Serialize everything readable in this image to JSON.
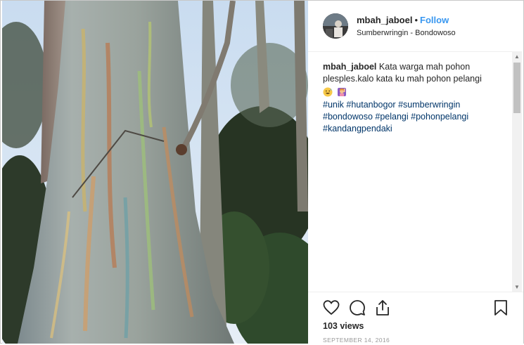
{
  "post": {
    "username": "mbah_jaboel",
    "separator": "•",
    "follow_label": "Follow",
    "location": "Sumberwringin - Bondowoso",
    "caption_user": "mbah_jaboel",
    "caption_text": "Kata warga mah pohon plesples.kalo kata ku mah pohon pelangi",
    "emojis": [
      "grinning-sweat-face-emoji",
      "person-raising-hand-emoji"
    ],
    "hashtags": [
      "#unik",
      "#hutanbogor",
      "#sumberwringin",
      "#bondowoso",
      "#pelangi",
      "#pohonpelangi",
      "#kandangpendaki"
    ],
    "views": "103 views",
    "date": "SEPTEMBER 14, 2016"
  },
  "icons": {
    "like": "heart-icon",
    "comment": "comment-icon",
    "share": "share-icon",
    "save": "bookmark-icon"
  },
  "colors": {
    "follow": "#3897f0",
    "hashtag": "#003569",
    "text": "#262626",
    "muted": "#999999"
  }
}
